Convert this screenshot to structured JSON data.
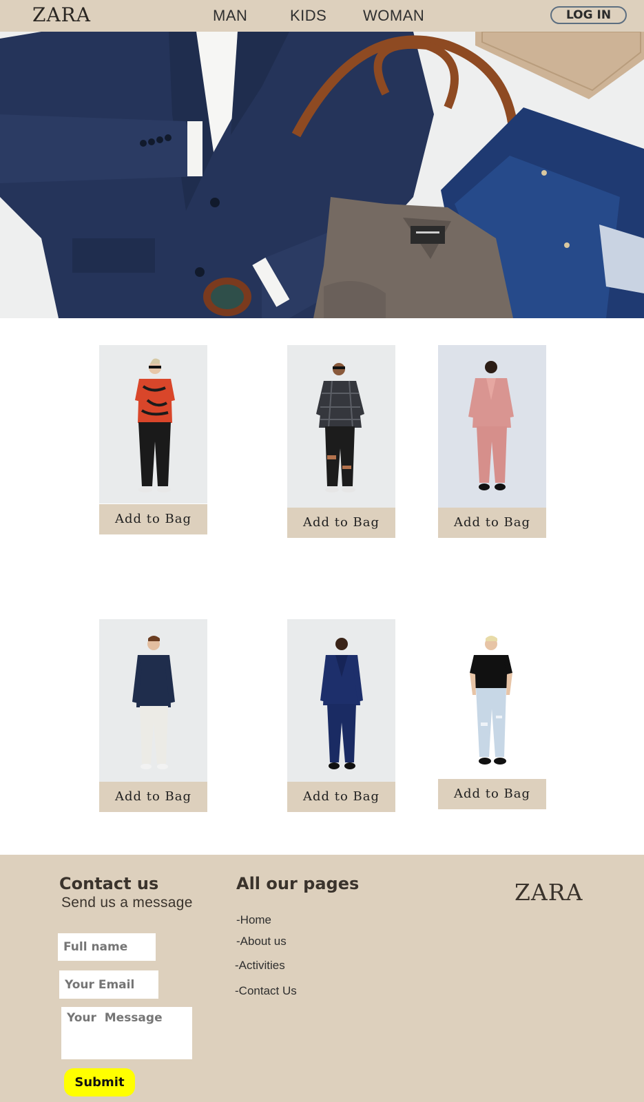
{
  "brand": "ZARA",
  "nav": {
    "items": [
      "MAN",
      "KIDS",
      "WOMAN"
    ],
    "login_label": "LOG IN"
  },
  "hero": {
    "alt": "Flat lay of navy blazer, leather belt, grey sweater and jeans"
  },
  "products": [
    {
      "button": "Add to Bag",
      "outfit": "orange printed shirt, black trousers"
    },
    {
      "button": "Add to Bag",
      "outfit": "dark patterned jacket, ripped black jeans"
    },
    {
      "button": "Add to Bag",
      "outfit": "pink suit"
    },
    {
      "button": "Add to Bag",
      "outfit": "navy shirt, white trousers"
    },
    {
      "button": "Add to Bag",
      "outfit": "navy suit"
    },
    {
      "button": "Add to Bag",
      "outfit": "black t-shirt, light ripped jeans"
    }
  ],
  "footer": {
    "contact_title": "Contact us",
    "contact_sub": "Send us a message",
    "name_placeholder": "Full name",
    "email_placeholder": "Your Email",
    "message_placeholder": "Your  Message",
    "submit_label": "Submit",
    "pages_title": "All our pages",
    "links": [
      "-Home",
      "-About us",
      "-Activities",
      "-Contact Us"
    ],
    "logo": "ZARA"
  },
  "colors": {
    "header_bg": "#ddd0bd",
    "footer_bg": "#ddd0bd",
    "button_bg": "#ddd0bd",
    "submit_bg": "#ffff00",
    "login_border": "#5c6e80"
  }
}
